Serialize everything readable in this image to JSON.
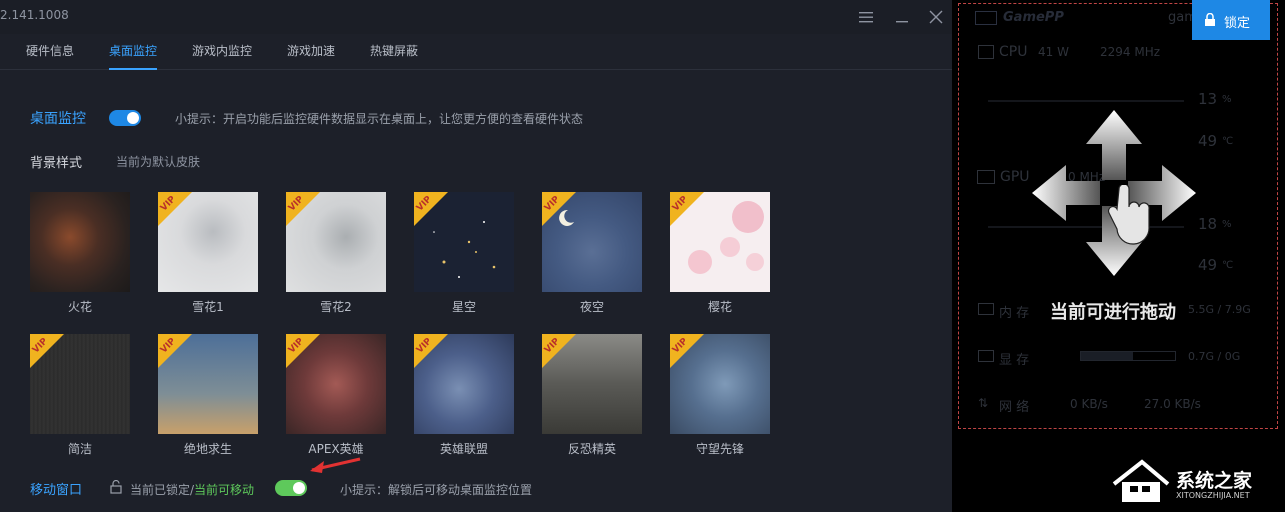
{
  "titlebar": {
    "version": "2.141.1008"
  },
  "tabs": [
    {
      "label": "硬件信息"
    },
    {
      "label": "桌面监控"
    },
    {
      "label": "游戏内监控"
    },
    {
      "label": "游戏加速"
    },
    {
      "label": "热键屏蔽"
    }
  ],
  "monitor": {
    "label": "桌面监控",
    "enabled": true,
    "hint": "小提示：开启功能后监控硬件数据显示在桌面上，让您更方便的查看硬件状态"
  },
  "background": {
    "title": "背景样式",
    "current": "当前为默认皮肤",
    "vip_label": "VIP",
    "skins": [
      {
        "label": "火花",
        "vip": false
      },
      {
        "label": "雪花1",
        "vip": true
      },
      {
        "label": "雪花2",
        "vip": true
      },
      {
        "label": "星空",
        "vip": true
      },
      {
        "label": "夜空",
        "vip": true
      },
      {
        "label": "樱花",
        "vip": true
      },
      {
        "label": "简洁",
        "vip": true
      },
      {
        "label": "绝地求生",
        "vip": true
      },
      {
        "label": "APEX英雄",
        "vip": true
      },
      {
        "label": "英雄联盟",
        "vip": true
      },
      {
        "label": "反恐精英",
        "vip": true
      },
      {
        "label": "守望先锋",
        "vip": true
      }
    ]
  },
  "move_window": {
    "label": "移动窗口",
    "status_locked": "当前已锁定/",
    "status_movable": "当前可移动",
    "enabled": true,
    "hint": "小提示：解锁后可移动桌面监控位置"
  },
  "overlay": {
    "lock_button": "锁定",
    "brand": "GamePP",
    "user": "gam",
    "cpu_label": "CPU",
    "cpu_power": "41 W",
    "cpu_freq": "2294 MHz",
    "cpu_usage": "13",
    "cpu_usage_unit": "%",
    "cpu_temp": "49",
    "cpu_temp_unit": "℃",
    "gpu_label": "GPU",
    "gpu_freq": "0 MHz",
    "gpu_usage": "18",
    "gpu_usage_unit": "%",
    "gpu_temp": "49",
    "gpu_temp_unit": "℃",
    "mem_label": "内  存",
    "mem_value": "5.5G / 7.9G",
    "vram_label": "显  存",
    "vram_value": "0.7G / 0G",
    "net_label": "网  络",
    "net_down": "0 KB/s",
    "net_up": "27.0 KB/s",
    "drag_text": "当前可进行拖动"
  },
  "watermark": {
    "name": "系统之家",
    "url": "XITONGZHIJIA.NET"
  },
  "colors": {
    "accent": "#3aa3ff",
    "toggle_green": "#5ec95b",
    "lock_blue": "#1e88e5",
    "vip_gold": "#f0b31f"
  }
}
